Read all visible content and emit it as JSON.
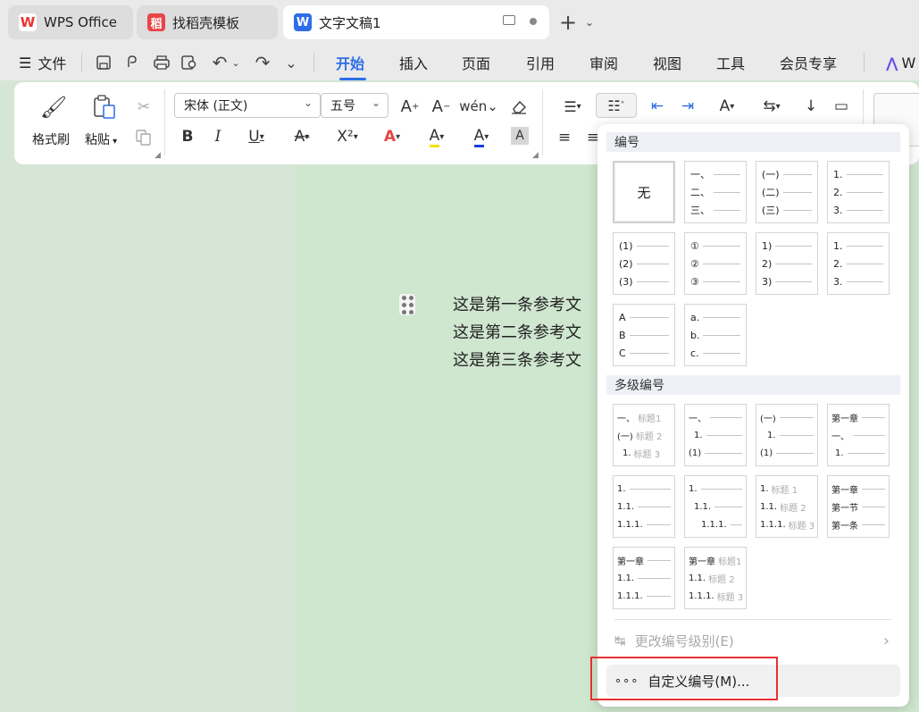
{
  "tabs": [
    {
      "label": "WPS Office",
      "icon": "wps-logo-icon",
      "icon_text": "W"
    },
    {
      "label": "找稻壳模板",
      "icon": "docer-icon",
      "icon_text": "稻"
    },
    {
      "label": "文字文稿1",
      "icon": "writer-doc-icon",
      "icon_text": "W"
    }
  ],
  "menu": {
    "file": "文件",
    "items": [
      "开始",
      "插入",
      "页面",
      "引用",
      "审阅",
      "视图",
      "工具",
      "会员专享"
    ],
    "active": "开始",
    "ai": "W"
  },
  "ribbon": {
    "format_painter": "格式刷",
    "paste": "粘贴",
    "font_name": "宋体 (正文)",
    "font_size": "五号",
    "bold": "B",
    "italic": "I",
    "underline": "U",
    "superscript": "X²",
    "font_color": "A",
    "highlight": "A",
    "shade": "A"
  },
  "document": {
    "lines": [
      "这是第一条参考文",
      "这是第二条参考文",
      "这是第三条参考文"
    ]
  },
  "numbering_menu": {
    "section_numbering": "编号",
    "section_multilevel": "多级编号",
    "none_label": "无",
    "cards": [
      [
        "一、",
        "二、",
        "三、"
      ],
      [
        "(一)",
        "(二)",
        "(三)"
      ],
      [
        "1.",
        "2.",
        "3."
      ],
      [
        "(1)",
        "(2)",
        "(3)"
      ],
      [
        "①",
        "②",
        "③"
      ],
      [
        "1)",
        "2)",
        "3)"
      ],
      [
        "1.",
        "2.",
        "3."
      ],
      [
        "A",
        "B",
        "C"
      ],
      [
        "a.",
        "b.",
        "c."
      ]
    ],
    "multilevel_cards": [
      [
        [
          "一、",
          "标题1"
        ],
        [
          "(一)",
          "标题 2"
        ],
        [
          "1.",
          "标题 3"
        ]
      ],
      [
        [
          "一、",
          ""
        ],
        [
          "1.",
          ""
        ],
        [
          "(1)",
          ""
        ]
      ],
      [
        [
          "(一)",
          ""
        ],
        [
          "1.",
          ""
        ],
        [
          "(1)",
          ""
        ]
      ],
      [
        [
          "第一章",
          ""
        ],
        [
          "一、",
          ""
        ],
        [
          "1.",
          ""
        ]
      ],
      [
        [
          "1.",
          ""
        ],
        [
          "1.1.",
          ""
        ],
        [
          "1.1.1.",
          ""
        ]
      ],
      [
        [
          "1.",
          ""
        ],
        [
          "1.1.",
          ""
        ],
        [
          "1.1.1.",
          ""
        ]
      ],
      [
        [
          "1.",
          "标题 1"
        ],
        [
          "1.1.",
          "标题 2"
        ],
        [
          "1.1.1.",
          "标题 3"
        ]
      ],
      [
        [
          "第一章",
          ""
        ],
        [
          "第一节",
          ""
        ],
        [
          "第一条",
          ""
        ]
      ],
      [
        [
          "第一章",
          ""
        ],
        [
          "1.1.",
          ""
        ],
        [
          "1.1.1.",
          ""
        ]
      ],
      [
        [
          "第一章",
          "标题1"
        ],
        [
          "1.1.",
          "标题 2"
        ],
        [
          "1.1.1.",
          "标题 3"
        ]
      ]
    ],
    "change_level": "更改编号级别(E)",
    "custom": "自定义编号(M)..."
  },
  "colors": {
    "accent": "#2d6ee8",
    "highlight_box": "#e53030",
    "doc_bg": "#cfe6cf"
  }
}
